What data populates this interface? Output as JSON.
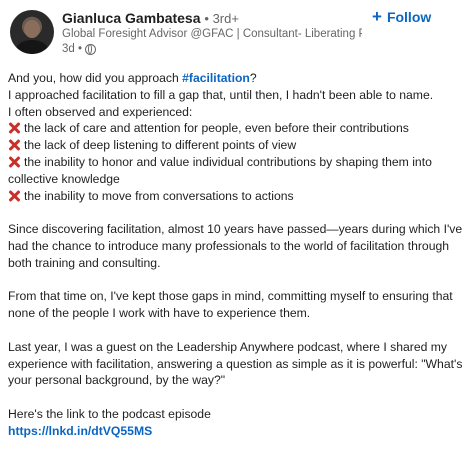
{
  "header": {
    "name": "Gianluca Gambatesa",
    "degree": "• 3rd+",
    "headline": "Global Foresight Advisor @GFAC | Consultant- Liberating Peo...",
    "time": "3d •",
    "visibility_icon": "globe-icon",
    "follow_label": "Follow"
  },
  "post": {
    "intro_prefix": "And you, how did you approach ",
    "intro_hashtag": "#facilitation",
    "intro_suffix": "?",
    "line2": "I approached facilitation to fill a gap that, until then, I hadn't been able to name.",
    "line3": "I often observed and experienced:",
    "bullets": [
      "the lack of care and attention for people, even before their contributions",
      "the lack of deep listening to different points of view",
      "the inability to honor and value individual contributions by shaping them into collective knowledge",
      "the inability to move from conversations to actions"
    ],
    "para2": "Since discovering facilitation, almost 10 years have passed—years during which I've had the chance to introduce many professionals to the world of facilitation through both training and consulting.",
    "para3": "From that time on, I've kept those gaps in mind, committing myself to ensuring that none of the people I work with have to experience them.",
    "para4": "Last year, I was a guest on the Leadership Anywhere podcast, where I shared my experience with facilitation, answering a question as simple as it is powerful: \"What's your personal background, by the way?\"",
    "para5": "Here's the link to the podcast episode",
    "link": "https://lnkd.in/dtVQ55MS"
  },
  "colors": {
    "accent": "#0a66c2",
    "bullet_icon": "#c8302a",
    "text": "#1f1f1f",
    "muted": "#666666"
  }
}
